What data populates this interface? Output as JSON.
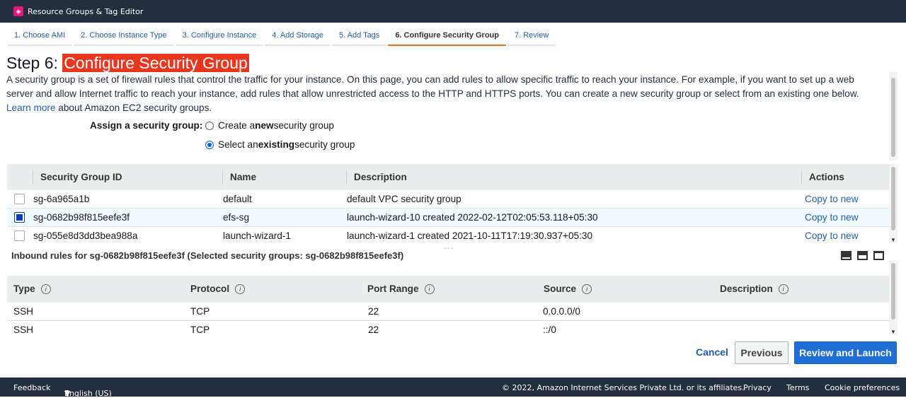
{
  "topbar": {
    "title": "Resource Groups & Tag Editor"
  },
  "tabs": [
    {
      "label": "1. Choose AMI"
    },
    {
      "label": "2. Choose Instance Type"
    },
    {
      "label": "3. Configure Instance"
    },
    {
      "label": "4. Add Storage"
    },
    {
      "label": "5. Add Tags"
    },
    {
      "label": "6. Configure Security Group",
      "active": true
    },
    {
      "label": "7. Review"
    }
  ],
  "header": {
    "step": "Step 6:",
    "title": "Configure Security Group",
    "description_1": "A security group is a set of firewall rules that control the traffic for your instance. On this page, you can add rules to allow specific traffic to reach your instance. For example, if you want to set up a web server and allow Internet traffic to reach your instance, add rules that allow unrestricted access to the HTTP and HTTPS ports. You can create a new security group or select from an existing one below.",
    "learn_more": "Learn more",
    "description_2": "about Amazon EC2 security groups."
  },
  "assign": {
    "label": "Assign a security group:",
    "option_new_pre": "Create a ",
    "option_new_bold": "new",
    "option_new_post": " security group",
    "option_existing_pre": "Select an ",
    "option_existing_bold": "existing",
    "option_existing_post": " security group",
    "selected": "existing"
  },
  "sg_table": {
    "columns": [
      "Security Group ID",
      "Name",
      "Description",
      "Actions"
    ],
    "rows": [
      {
        "id": "sg-6a965a1b",
        "name": "default",
        "description": "default VPC security group",
        "action": "Copy to new",
        "checked": false
      },
      {
        "id": "sg-0682b98f815eefe3f",
        "name": "efs-sg",
        "description": "launch-wizard-10 created 2022-02-12T02:05:53.118+05:30",
        "action": "Copy to new",
        "checked": true
      },
      {
        "id": "sg-055e8d3dd3bea988a",
        "name": "launch-wizard-1",
        "description": "launch-wizard-1 created 2021-10-11T17:19:30.937+05:30",
        "action": "Copy to new",
        "checked": false
      }
    ]
  },
  "inbound": {
    "title": "Inbound rules for sg-0682b98f815eefe3f (Selected security groups: sg-0682b98f815eefe3f)",
    "columns": [
      "Type",
      "Protocol",
      "Port Range",
      "Source",
      "Description"
    ],
    "rows": [
      {
        "type": "SSH",
        "protocol": "TCP",
        "port": "22",
        "source": "0.0.0.0/0",
        "description": ""
      },
      {
        "type": "SSH",
        "protocol": "TCP",
        "port": "22",
        "source": "::/0",
        "description": ""
      }
    ]
  },
  "buttons": {
    "cancel": "Cancel",
    "previous": "Previous",
    "launch": "Review and Launch"
  },
  "footer": {
    "feedback": "Feedback",
    "language": "English (US)",
    "copyright": "© 2022, Amazon Internet Services Private Ltd. or its affiliates.",
    "privacy": "Privacy",
    "terms": "Terms",
    "cookies": "Cookie preferences"
  },
  "colors": {
    "accent": "#ec7211",
    "link": "#1e5fb3",
    "highlight": "#e9371f",
    "nav_bg": "#232f3e",
    "primary_button": "#1f6fd6"
  }
}
